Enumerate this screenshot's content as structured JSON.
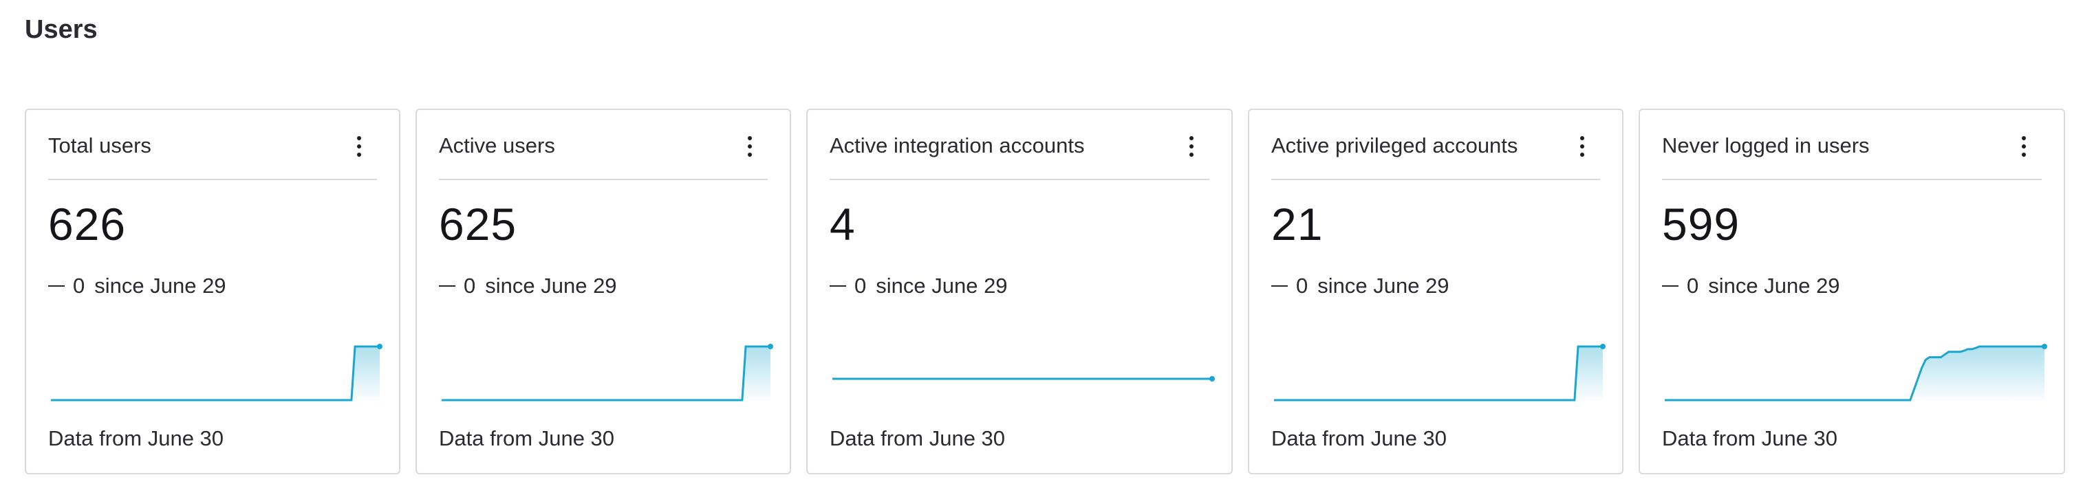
{
  "page": {
    "title": "Users"
  },
  "accent_color": "#1aa7cf",
  "cards": [
    {
      "title": "Total users",
      "value": "626",
      "delta_value": "0",
      "delta_text": "since June 29",
      "footer": "Data from June 30",
      "menu_icon": "kebab-icon",
      "trend": [
        0,
        0,
        0,
        0,
        0,
        0,
        0,
        0,
        0,
        0,
        0,
        0,
        0,
        0,
        0,
        0,
        0,
        0,
        0,
        0,
        0,
        0,
        0,
        0,
        0,
        0,
        0,
        0,
        0,
        0,
        0,
        0,
        0,
        0,
        0,
        0,
        0,
        0,
        0,
        0,
        0,
        0,
        0,
        0,
        0,
        0,
        0,
        0,
        0,
        0,
        0,
        0,
        0,
        0,
        0,
        0,
        0,
        0,
        0,
        0,
        0,
        0,
        0,
        0,
        0,
        0,
        0,
        0,
        0,
        0,
        0,
        0,
        0,
        0,
        0,
        0,
        0,
        0,
        0,
        0,
        0,
        0,
        0,
        0,
        0,
        0,
        1,
        1,
        1,
        1,
        1,
        1,
        1,
        1
      ]
    },
    {
      "title": "Active users",
      "value": "625",
      "delta_value": "0",
      "delta_text": "since June 29",
      "footer": "Data from June 30",
      "menu_icon": "kebab-icon",
      "trend": [
        0,
        0,
        0,
        0,
        0,
        0,
        0,
        0,
        0,
        0,
        0,
        0,
        0,
        0,
        0,
        0,
        0,
        0,
        0,
        0,
        0,
        0,
        0,
        0,
        0,
        0,
        0,
        0,
        0,
        0,
        0,
        0,
        0,
        0,
        0,
        0,
        0,
        0,
        0,
        0,
        0,
        0,
        0,
        0,
        0,
        0,
        0,
        0,
        0,
        0,
        0,
        0,
        0,
        0,
        0,
        0,
        0,
        0,
        0,
        0,
        0,
        0,
        0,
        0,
        0,
        0,
        0,
        0,
        0,
        0,
        0,
        0,
        0,
        0,
        0,
        0,
        0,
        0,
        0,
        0,
        0,
        0,
        0,
        0,
        0,
        0,
        1,
        1,
        1,
        1,
        1,
        1,
        1,
        1
      ]
    },
    {
      "title": "Active integration accounts",
      "value": "4",
      "delta_value": "0",
      "delta_text": "since June 29",
      "footer": "Data from June 30",
      "menu_icon": "kebab-icon",
      "trend": [
        1,
        1,
        1,
        1,
        1,
        1,
        1,
        1,
        1,
        1,
        1,
        1,
        1,
        1,
        1,
        1,
        1,
        1,
        1,
        1,
        1,
        1,
        1,
        1,
        1,
        1,
        1,
        1,
        1,
        1,
        1,
        1,
        1,
        1,
        1,
        1,
        1,
        1,
        1,
        1,
        1,
        1,
        1,
        1,
        1,
        1,
        1,
        1,
        1,
        1,
        1,
        1,
        1,
        1,
        1,
        1,
        1,
        1,
        1,
        1,
        1,
        1,
        1,
        1,
        1,
        1,
        1,
        1,
        1,
        1,
        1,
        1,
        1,
        1,
        1,
        1,
        1,
        1,
        1,
        1,
        1,
        1,
        1,
        1,
        1,
        1,
        1,
        1,
        1,
        1,
        1,
        1,
        1,
        1
      ]
    },
    {
      "title": "Active privileged accounts",
      "value": "21",
      "delta_value": "0",
      "delta_text": "since June 29",
      "footer": "Data from June 30",
      "menu_icon": "kebab-icon",
      "trend": [
        0,
        0,
        0,
        0,
        0,
        0,
        0,
        0,
        0,
        0,
        0,
        0,
        0,
        0,
        0,
        0,
        0,
        0,
        0,
        0,
        0,
        0,
        0,
        0,
        0,
        0,
        0,
        0,
        0,
        0,
        0,
        0,
        0,
        0,
        0,
        0,
        0,
        0,
        0,
        0,
        0,
        0,
        0,
        0,
        0,
        0,
        0,
        0,
        0,
        0,
        0,
        0,
        0,
        0,
        0,
        0,
        0,
        0,
        0,
        0,
        0,
        0,
        0,
        0,
        0,
        0,
        0,
        0,
        0,
        0,
        0,
        0,
        0,
        0,
        0,
        0,
        0,
        0,
        0,
        0,
        0,
        0,
        0,
        0,
        0,
        0,
        1,
        1,
        1,
        1,
        1,
        1,
        1,
        1
      ]
    },
    {
      "title": "Never logged in users",
      "value": "599",
      "delta_value": "0",
      "delta_text": "since June 29",
      "footer": "Data from June 30",
      "menu_icon": "kebab-icon",
      "trend": [
        0,
        0,
        0,
        0,
        0,
        0,
        0,
        0,
        0,
        0,
        0,
        0,
        0,
        0,
        0,
        0,
        0,
        0,
        0,
        0,
        0,
        0,
        0,
        0,
        0,
        0,
        0,
        0,
        0,
        0,
        0,
        0,
        0,
        0,
        0,
        0,
        0,
        0,
        0,
        0,
        0,
        0,
        0,
        0,
        0,
        0,
        0,
        0,
        0,
        0,
        0,
        0,
        0,
        0,
        0,
        0,
        0,
        0,
        0,
        0,
        0,
        0,
        0,
        0,
        0,
        0.2,
        0.4,
        0.6,
        0.75,
        0.8,
        0.8,
        0.8,
        0.8,
        0.85,
        0.9,
        0.9,
        0.9,
        0.9,
        0.92,
        0.95,
        0.95,
        0.97,
        1,
        1,
        1,
        1,
        1,
        1,
        1,
        1,
        1,
        1,
        1,
        1,
        1,
        1,
        1,
        1,
        1,
        1
      ]
    }
  ]
}
